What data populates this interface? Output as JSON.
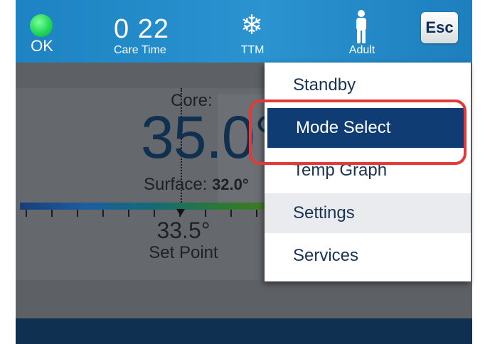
{
  "header": {
    "status_label": "OK",
    "status_color": "#22d85a",
    "care_time_value": "0 22",
    "care_time_label": "Care Time",
    "mode_icon": "snowflake-icon",
    "mode_label": "TTM",
    "patient_icon": "person-icon",
    "patient_label": "Adult",
    "esc_label": "Esc"
  },
  "temperature": {
    "core_label": "Core:",
    "core_value": "35.0°",
    "surface_label": "Surface:",
    "surface_value": "32.0°",
    "set_point_value": "33.5°",
    "set_point_label": "Set Point"
  },
  "menu": {
    "items": [
      {
        "label": "Standby"
      },
      {
        "label": "Mode Select"
      },
      {
        "label": "Temp Graph"
      },
      {
        "label": "Settings"
      },
      {
        "label": "Services"
      }
    ],
    "selected": "Mode Select",
    "highlight_color": "#e03a3a"
  }
}
